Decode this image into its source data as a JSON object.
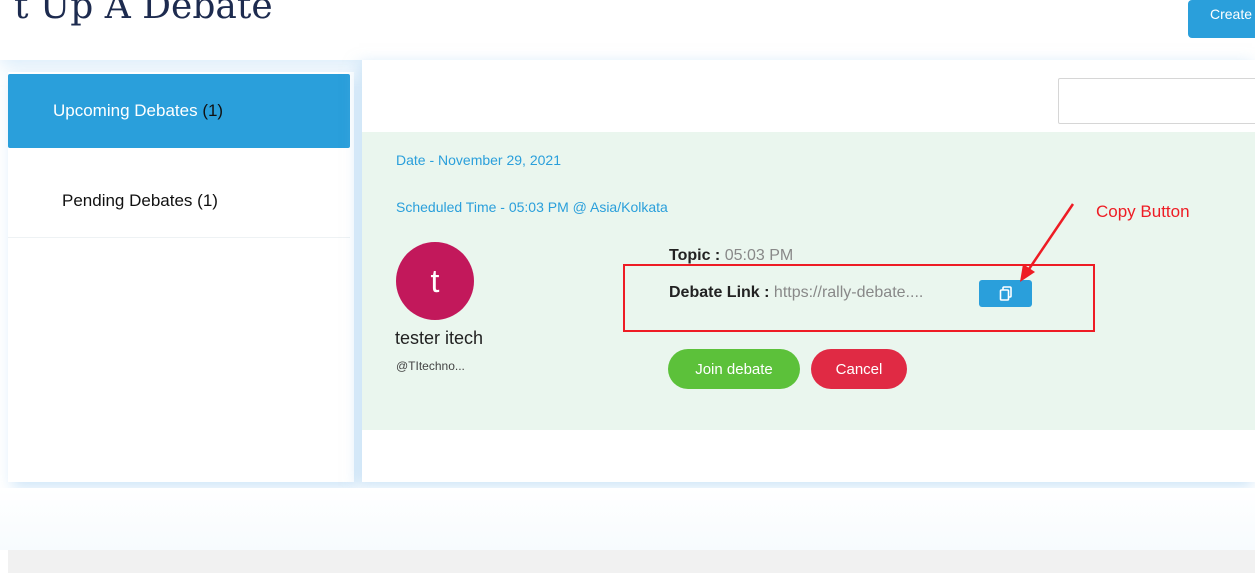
{
  "header": {
    "title": "t Up A Debate",
    "create_label": "Create"
  },
  "sidebar": {
    "items": [
      {
        "label": "Upcoming Debates",
        "count": "(1)",
        "active": true
      },
      {
        "label": "Pending Debates",
        "count": "(1)",
        "active": false
      }
    ]
  },
  "search": {
    "value": "",
    "placeholder": ""
  },
  "debate": {
    "date": "Date - November 29, 2021",
    "scheduled_time": "Scheduled Time - 05:03 PM @ Asia/Kolkata",
    "avatar_letter": "t",
    "user_name": "tester itech",
    "user_handle": "@TItechno...",
    "topic_label": "Topic :",
    "topic_value": "05:03 PM",
    "link_label": "Debate Link :",
    "link_value": "https://rally-debate....",
    "copy_icon": "copy-icon",
    "join_label": "Join debate",
    "cancel_label": "Cancel"
  },
  "annotation": {
    "label": "Copy Button",
    "color": "#ee1c24"
  },
  "colors": {
    "accent": "#2a9fdb",
    "card_bg": "#eaf6ee",
    "join": "#5cc13a",
    "cancel": "#e02a44",
    "avatar": "#c2185b"
  }
}
